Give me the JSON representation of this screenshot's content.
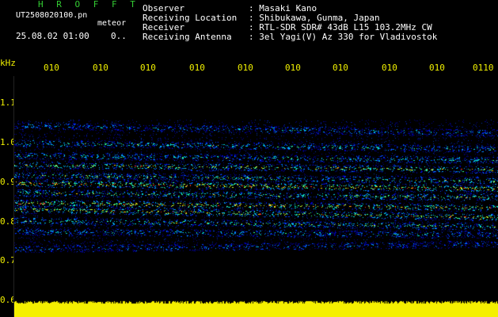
{
  "header": {
    "app_name": "H R O F F T",
    "filename": "UT2508020100.pn",
    "mode": "meteor",
    "datetime": "25.08.02 01:00",
    "extra": "0..",
    "labels": [
      "Observer",
      "Receiving Location",
      "Receiver",
      "Receiving Antenna"
    ],
    "values": [
      ": Masaki Kano",
      ": Shibukawa, Gunma, Japan",
      ": RTL-SDR SDR# 43dB L15 103.2MHz CW",
      ": 3el Yagi(V) Az 330 for Vladivostok"
    ]
  },
  "y_axis": {
    "unit": "kHz",
    "ticks": [
      "1.1",
      "1.0",
      "0.9",
      "0.8",
      "0.7",
      "0.6"
    ]
  },
  "x_axis": {
    "ticks": [
      "010",
      "010",
      "010",
      "010",
      "010",
      "010",
      "010",
      "010",
      "010",
      "0110"
    ]
  },
  "colors": {
    "background": "#000000",
    "app_green": "#33cc33",
    "axis_yellow": "#f0f000",
    "signal_low": "#0000aa",
    "signal_mid": "#00ffff",
    "signal_high": "#ffff00",
    "signal_peak": "#ff2020"
  }
}
